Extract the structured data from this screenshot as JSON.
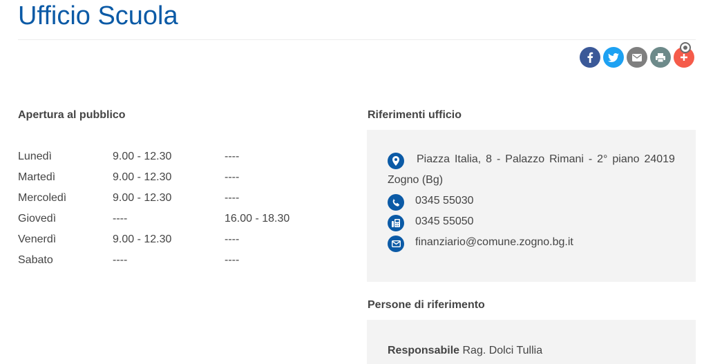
{
  "page": {
    "title": "Ufficio Scuola"
  },
  "share": {
    "buttons": [
      {
        "name": "facebook",
        "icon": "facebook-icon",
        "color": "#3b5998"
      },
      {
        "name": "twitter",
        "icon": "twitter-icon",
        "color": "#1da1f2"
      },
      {
        "name": "email",
        "icon": "email-icon",
        "color": "#7f7f7f"
      },
      {
        "name": "print",
        "icon": "print-icon",
        "color": "#6d8a8a"
      },
      {
        "name": "more",
        "icon": "plus-icon",
        "color": "#f55b4a"
      }
    ]
  },
  "opening": {
    "heading": "Apertura al pubblico",
    "rows": [
      {
        "day": "Lunedì",
        "morning": "9.00 - 12.30",
        "afternoon": "----"
      },
      {
        "day": "Martedì",
        "morning": "9.00 - 12.30",
        "afternoon": "----"
      },
      {
        "day": "Mercoledì",
        "morning": "9.00 - 12.30",
        "afternoon": "----"
      },
      {
        "day": "Giovedì",
        "morning": "----",
        "afternoon": "16.00 - 18.30"
      },
      {
        "day": "Venerdì",
        "morning": "9.00 - 12.30",
        "afternoon": "----"
      },
      {
        "day": "Sabato",
        "morning": "----",
        "afternoon": "----"
      }
    ]
  },
  "office": {
    "heading": "Riferimenti ufficio",
    "address_words": [
      "Piazza",
      "Italia,",
      "8",
      "-",
      "Palazzo",
      "Rimani",
      "-",
      "2°",
      "piano",
      "24019"
    ],
    "address_line2": "Zogno (Bg)",
    "phone": "0345 55030",
    "fax": "0345 55050",
    "email": "finanziario@comune.zogno.bg.it",
    "icon_color": "#0b5aa6"
  },
  "people": {
    "heading": "Persone di riferimento",
    "role_label": "Responsabile",
    "person_name": "Rag. Dolci Tullia"
  }
}
